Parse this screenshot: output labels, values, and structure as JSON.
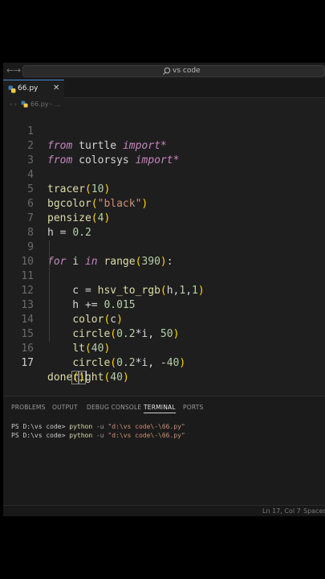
{
  "titlebar": {
    "back_arrow": "←",
    "forward_arrow": "→",
    "search_text": "vs code"
  },
  "tab": {
    "label": "66.py",
    "close": "✕"
  },
  "breadcrumb": {
    "arrows": "‹ ›",
    "file": "66.py",
    "separator": "› ..."
  },
  "editor": {
    "line_numbers": [
      "1",
      "2",
      "3",
      "4",
      "5",
      "6",
      "7",
      "8",
      "9",
      "10",
      "11",
      "12",
      "13",
      "14",
      "15",
      "16",
      "17"
    ],
    "current_line": 17
  },
  "panel": {
    "tabs": [
      "PROBLEMS",
      "OUTPUT",
      "DEBUG CONSOLE",
      "TERMINAL",
      "PORTS"
    ],
    "active_tab": "TERMINAL",
    "terminal_lines": [
      {
        "prompt": "PS D:\\vs code> ",
        "cmd": "python",
        "flag": " -u ",
        "arg": "\"d:\\vs code\\-\\66.py\""
      },
      {
        "prompt": "PS D:\\vs code> ",
        "cmd": "python",
        "flag": " -u ",
        "arg": "\"d:\\vs code\\-\\66.py\""
      }
    ]
  },
  "statusbar": {
    "position": "Ln 17, Col 7",
    "spaces": "Spaces"
  },
  "colors": {
    "keyword": "#c586c0",
    "function": "#dcdcaa",
    "string": "#ce9178",
    "number": "#b5cea8",
    "bracket_level1": "#ffd700",
    "bracket_level2": "#da70d6",
    "bracket_level3": "#179fff",
    "active_tab_border": "#3f8bd6"
  }
}
